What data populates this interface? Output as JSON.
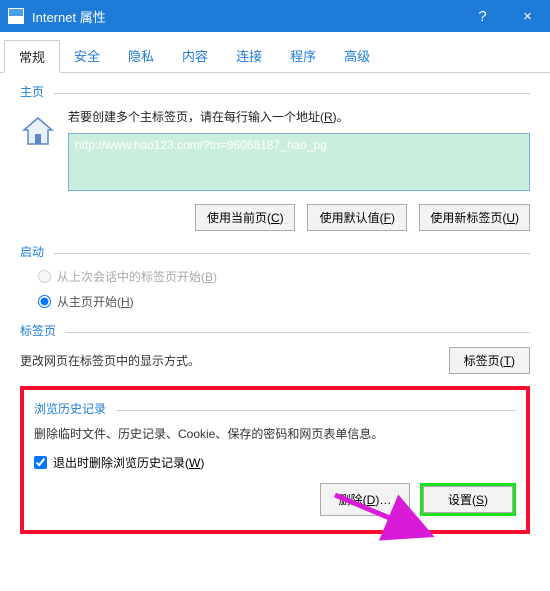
{
  "titlebar": {
    "title": "Internet 属性",
    "help": "?",
    "close": "×"
  },
  "tabs": {
    "t0": "常规",
    "t1": "安全",
    "t2": "隐私",
    "t3": "内容",
    "t4": "连接",
    "t5": "程序",
    "t6": "高级"
  },
  "home": {
    "groupLabel": "主页",
    "prompt_pre": "若要创建多个主标签页，请在每行输入一个地址(",
    "prompt_m": "R",
    "prompt_post": ")。",
    "url": "http://www.hao123.com/?tn=96066187_hao_pg",
    "btnCurrent_pre": "使用当前页(",
    "btnCurrent_m": "C",
    "btnCurrent_post": ")",
    "btnDefault_pre": "使用默认值(",
    "btnDefault_m": "F",
    "btnDefault_post": ")",
    "btnNewTab_pre": "使用新标签页(",
    "btnNewTab_m": "U",
    "btnNewTab_post": ")"
  },
  "startup": {
    "groupLabel": "启动",
    "optLast_pre": "从上次会话中的标签页开始(",
    "optLast_m": "B",
    "optLast_post": ")",
    "optHome_pre": "从主页开始(",
    "optHome_m": "H",
    "optHome_post": ")"
  },
  "tabsSection": {
    "groupLabel": "标签页",
    "text": "更改网页在标签页中的显示方式。",
    "btn_pre": "标签页(",
    "btn_m": "T",
    "btn_post": ")"
  },
  "history": {
    "groupLabel": "浏览历史记录",
    "desc": "删除临时文件、历史记录、Cookie、保存的密码和网页表单信息。",
    "chk_pre": "退出时删除浏览历史记录(",
    "chk_m": "W",
    "chk_post": ")",
    "btnDel_pre": "删除(",
    "btnDel_m": "D",
    "btnDel_post": ")…",
    "btnSet_pre": "设置(",
    "btnSet_m": "S",
    "btnSet_post": ")"
  }
}
